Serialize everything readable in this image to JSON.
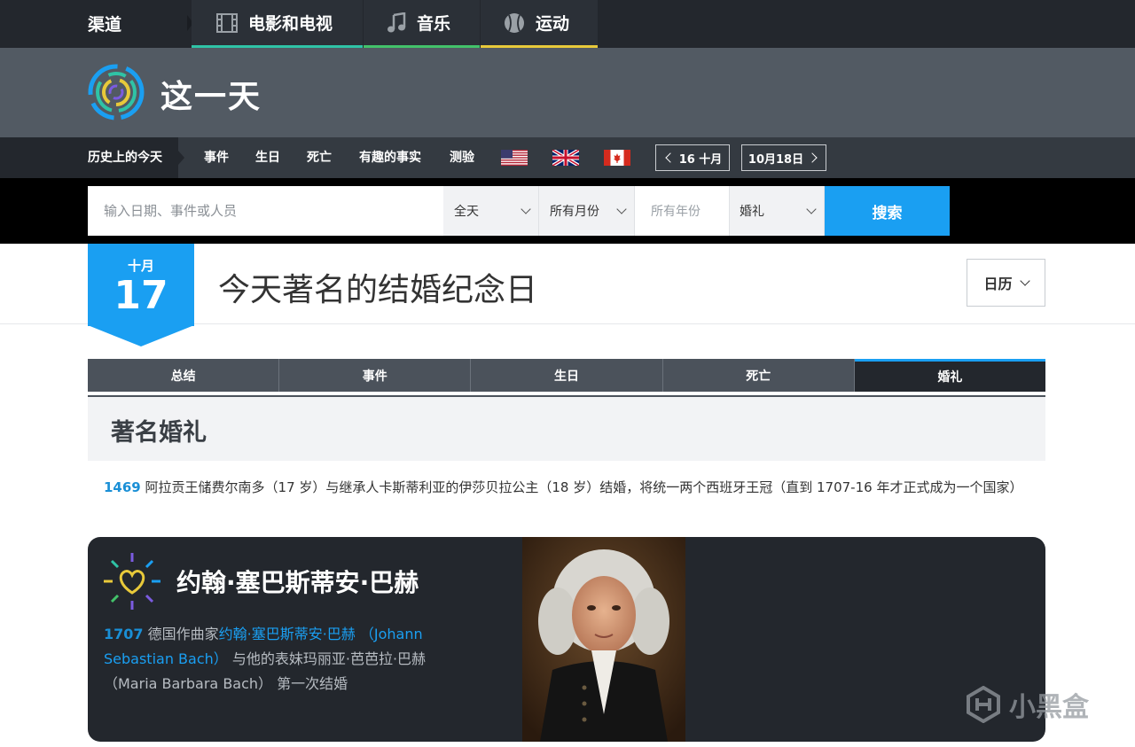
{
  "topbar": {
    "channels_label": "渠道",
    "tabs": [
      {
        "label": "电影和电视",
        "icon": "film-icon"
      },
      {
        "label": "音乐",
        "icon": "music-note-icon"
      },
      {
        "label": "运动",
        "icon": "baseball-icon"
      }
    ]
  },
  "banner": {
    "site_title": "这一天"
  },
  "subnav": {
    "today_in_history": "历史上的今天",
    "items": [
      "事件",
      "生日",
      "死亡",
      "有趣的事实",
      "测验"
    ],
    "prev_date": "16 十月",
    "next_date": "10月18日"
  },
  "search": {
    "placeholder": "输入日期、事件或人员",
    "day_select": "全天",
    "month_select": "所有月份",
    "year_placeholder": "所有年份",
    "category_select": "婚礼",
    "button_label": "搜索"
  },
  "date_badge": {
    "month": "十月",
    "day": "17"
  },
  "page_title": "今天著名的结婚纪念日",
  "calendar_button": "日历",
  "tabs": [
    {
      "label": "总结",
      "active": false
    },
    {
      "label": "事件",
      "active": false
    },
    {
      "label": "生日",
      "active": false
    },
    {
      "label": "死亡",
      "active": false
    },
    {
      "label": "婚礼",
      "active": true
    }
  ],
  "section_title": "著名婚礼",
  "event": {
    "year": "1469",
    "text": " 阿拉贡王储费尔南多（17 岁）与继承人卡斯蒂利亚的伊莎贝拉公主（18 岁）结婚，将统一两个西班牙王冠（直到 1707-16 年才正式成为一个国家）"
  },
  "feature": {
    "title": "约翰·塞巴斯蒂安·巴赫",
    "year": "1707",
    "text_before": " 德国作曲家",
    "link_text": "约翰·塞巴斯蒂安·巴赫 （Johann Sebastian Bach）",
    "text_after": " 与他的表妹玛丽亚·芭芭拉·巴赫（Maria Barbara Bach） 第一次结婚"
  },
  "watermark": "小黑盒",
  "colors": {
    "accent_blue": "#1a9ff2",
    "dark_bg": "#23272d",
    "banner_bg": "#525a63"
  }
}
